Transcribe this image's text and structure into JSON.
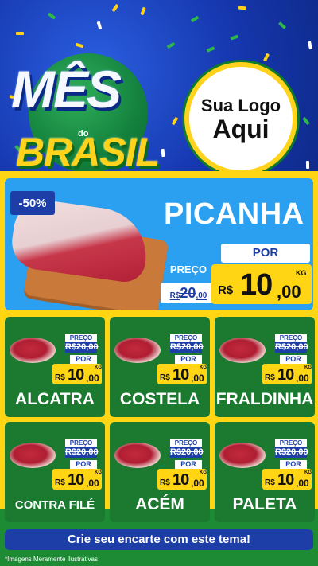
{
  "header": {
    "title_line1": "MÊS",
    "title_do": "do",
    "title_line2": "BRASIL",
    "logo_line1": "Sua Logo",
    "logo_line2": "Aqui"
  },
  "hero": {
    "discount": "-50%",
    "name": "PICANHA",
    "preco_label": "PREÇO",
    "old_rs": "R$",
    "old_int": "20",
    "old_dec": ",00",
    "por_label": "POR",
    "rs": "R$",
    "price_int": "10",
    "price_dec": ",00",
    "unit": "KG"
  },
  "products": [
    {
      "name": "ALCATRA",
      "preco_label": "PREÇO",
      "old_price": "R$20,00",
      "por_label": "POR",
      "rs": "R$",
      "price_int": "10",
      "price_dec": ",00",
      "unit": "KG"
    },
    {
      "name": "COSTELA",
      "preco_label": "PREÇO",
      "old_price": "R$20,00",
      "por_label": "POR",
      "rs": "R$",
      "price_int": "10",
      "price_dec": ",00",
      "unit": "KG"
    },
    {
      "name": "FRALDINHA",
      "preco_label": "PREÇO",
      "old_price": "R$20,00",
      "por_label": "POR",
      "rs": "R$",
      "price_int": "10",
      "price_dec": ",00",
      "unit": "KG"
    },
    {
      "name": "CONTRA FILÉ",
      "preco_label": "PREÇO",
      "old_price": "R$20,00",
      "por_label": "POR",
      "rs": "R$",
      "price_int": "10",
      "price_dec": ",00",
      "unit": "KG"
    },
    {
      "name": "ACÉM",
      "preco_label": "PREÇO",
      "old_price": "R$20,00",
      "por_label": "POR",
      "rs": "R$",
      "price_int": "10",
      "price_dec": ",00",
      "unit": "KG"
    },
    {
      "name": "PALETA",
      "preco_label": "PREÇO",
      "old_price": "R$20,00",
      "por_label": "POR",
      "rs": "R$",
      "price_int": "10",
      "price_dec": ",00",
      "unit": "KG"
    }
  ],
  "cta": "Crie seu encarte com este tema!",
  "disclaimer": "*Imagens Meramente Ilustrativas",
  "colors": {
    "blue": "#1c3ea6",
    "yellow": "#ffd514",
    "green": "#1b7a2f",
    "sky": "#2b9ff0"
  }
}
